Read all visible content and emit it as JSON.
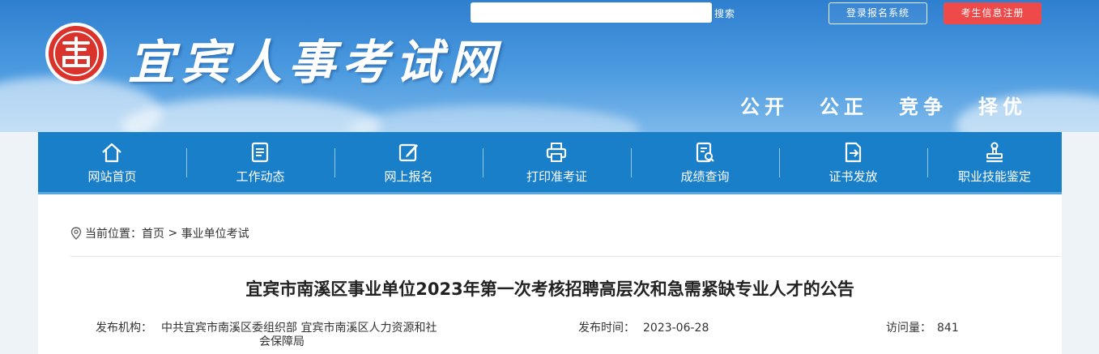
{
  "header": {
    "site_title": "宜宾人事考试网",
    "search_placeholder": "",
    "search_label": "搜索",
    "login_label": "登录报名系统",
    "register_label": "考生信息注册",
    "slogans": [
      "公开",
      "公正",
      "竞争",
      "择优"
    ]
  },
  "nav": {
    "items": [
      {
        "label": "网站首页",
        "icon": "home-icon"
      },
      {
        "label": "工作动态",
        "icon": "document-list-icon"
      },
      {
        "label": "网上报名",
        "icon": "edit-icon"
      },
      {
        "label": "打印准考证",
        "icon": "printer-icon"
      },
      {
        "label": "成绩查询",
        "icon": "search-document-icon"
      },
      {
        "label": "证书发放",
        "icon": "certificate-export-icon"
      },
      {
        "label": "职业技能鉴定",
        "icon": "stamp-icon"
      }
    ]
  },
  "breadcrumb": {
    "prefix": "当前位置：",
    "home": "首页",
    "separator": ">",
    "current": "事业单位考试"
  },
  "article": {
    "title": "宜宾市南溪区事业单位2023年第一次考核招聘高层次和急需紧缺专业人才的公告",
    "publisher_label": "发布机构：",
    "publisher_line1": "中共宜宾市南溪区委组织部 宜宾市南溪区人力资源和社",
    "publisher_line2": "会保障局",
    "date_label": "发布时间：",
    "date": "2023-06-28",
    "views_label": "访问量：",
    "views": "841"
  },
  "colors": {
    "nav_bg": "#1a7fc9",
    "register_btn": "#ef4a4a",
    "logo_red": "#d9332b"
  }
}
